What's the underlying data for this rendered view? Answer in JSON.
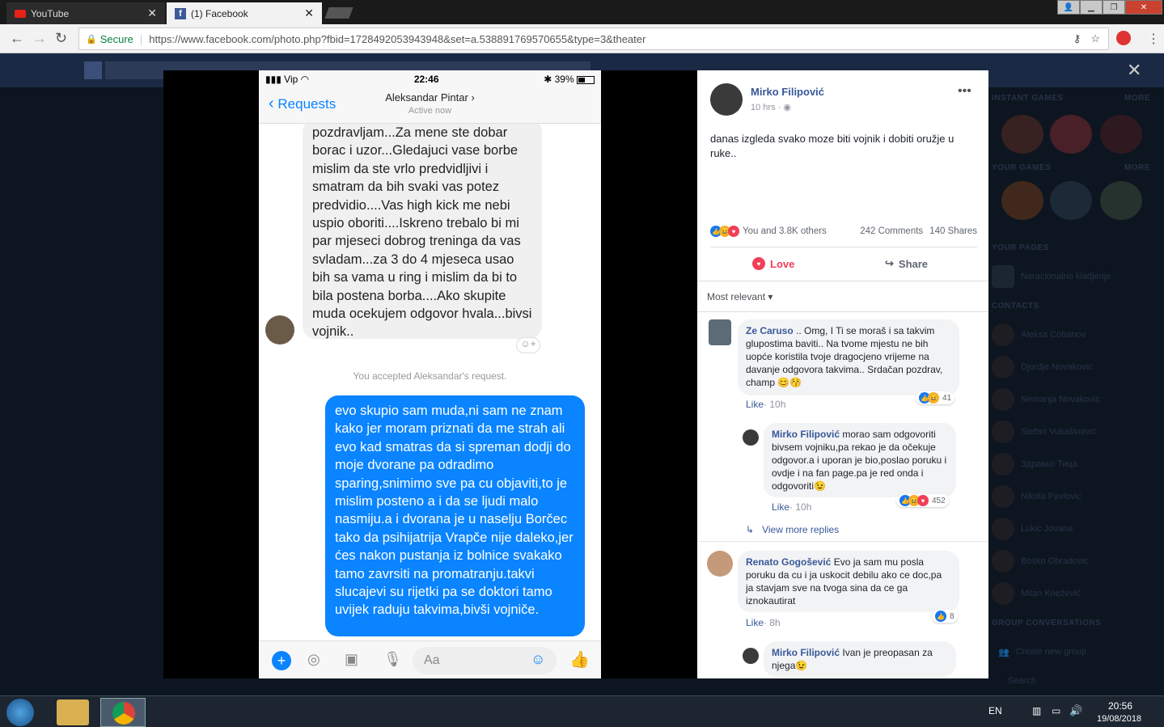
{
  "browser": {
    "tabs": [
      {
        "label": "YouTube",
        "icon": "youtube-icon"
      },
      {
        "label": "(1) Facebook",
        "icon": "facebook-icon"
      }
    ],
    "secure_label": "Secure",
    "url": "https://www.facebook.com/photo.php?fbid=1728492053943948&set=a.538891769570655&type=3&theater"
  },
  "phone": {
    "carrier": "Vip",
    "time": "22:46",
    "battery": "39%",
    "back_label": "Requests",
    "contact_name": "Aleksandar Pintar",
    "contact_status": "Active now",
    "incoming_message": "pozdravljam...Za mene ste dobar borac i uzor...Gledajuci vase borbe mislim da ste vrlo predvidljivi i smatram da bih svaki vas potez predvidio....Vas high kick me nebi uspio oboriti....Iskreno trebalo bi mi par mjeseci dobrog treninga da vas svladam...za 3 do 4 mjeseca usao bih sa vama u ring i mislim da bi to bila postena borba....Ako skupite muda ocekujem odgovor hvala...bivsi vojnik..",
    "accepted_notice": "You accepted Aleksandar's request.",
    "outgoing_message": "evo skupio sam muda,ni sam ne znam kako jer moram priznati da me strah ali evo kad smatras da si spreman dodji do moje dvorane pa odradimo sparing,snimimo sve pa cu objaviti,to je mislim posteno a i da se ljudi malo nasmiju.a i dvorana je u naselju Borčec tako da psihijatrija Vrapče nije daleko,jer ćes nakon pustanja iz bolnice svakako tamo zavrsiti na promatranju.takvi slucajevi su rijetki pa se doktori tamo uvijek raduju takvima,bivši vojniče.",
    "composer_placeholder": "Aa"
  },
  "post": {
    "author": "Mirko Filipović",
    "time": "10 hrs",
    "text": "danas izgleda svako moze biti vojnik i dobiti oružje u ruke..",
    "reactions_summary": "You and 3.8K others",
    "comments_count": "242 Comments",
    "shares_count": "140 Shares",
    "love_label": "Love",
    "share_label": "Share",
    "sort_label": "Most relevant",
    "like_label": "Like",
    "view_more_replies": "View more replies",
    "comments": [
      {
        "author": "Ze Caruso",
        "text": ".. Omg, I Ti se moraš i sa takvim glupostima baviti.. Na tvome mjestu ne bih uopće koristila tvoje dragocjeno vrijeme na davanje odgovora takvima.. Srdačan pozdrav, champ 😊😚",
        "time": "10h",
        "reactions": "41"
      },
      {
        "author": "Mirko Filipović",
        "text": "morao sam odgovoriti bivsem vojniku,pa rekao je da očekuje odgovor.a i uporan je bio,poslao poruku i ovdje i na fan page.pa je red onda i odgovoriti😉",
        "time": "10h",
        "reactions": "452"
      },
      {
        "author": "Renato Gogošević",
        "text": "Evo ja sam mu posla poruku da cu i ja uskocit debilu ako ce doc,pa ja stavjam sve na tvoga sina da ce ga iznokautirat",
        "time": "8h",
        "reactions": "8"
      },
      {
        "author": "Mirko Filipović",
        "text": "Ivan je preopasan za njega😉"
      }
    ]
  },
  "sidebar": {
    "instant_games": "INSTANT GAMES",
    "your_games": "YOUR GAMES",
    "more": "MORE",
    "your_pages": "YOUR PAGES",
    "page_name": "Neracionalno kladjenje",
    "contacts_header": "CONTACTS",
    "contacts": [
      "Aleksa Cobanov",
      "Djordje Novakovic",
      "Nemanja Novakovic",
      "Stefan Vukašinović",
      "Здравко Тица",
      "Nikola Pavlovic",
      "Lukić Jovana",
      "Bosko Obradovic",
      "Milan Knežević"
    ],
    "group_conversations": "GROUP CONVERSATIONS",
    "create_group": "Create new group",
    "search_placeholder": "Search"
  },
  "taskbar": {
    "lang": "EN",
    "time": "20:56",
    "date": "19/08/2018"
  }
}
